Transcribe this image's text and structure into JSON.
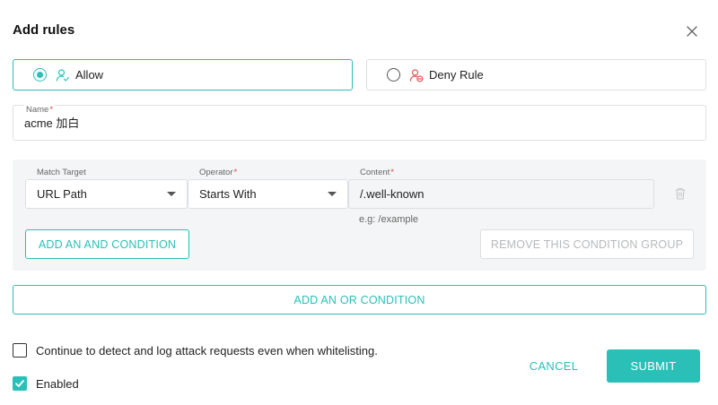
{
  "dialog": {
    "title": "Add rules"
  },
  "rule_types": {
    "allow": {
      "label": "Allow",
      "selected": true,
      "icon": "user-check-icon"
    },
    "deny": {
      "label": "Deny Rule",
      "selected": false,
      "icon": "user-block-icon"
    }
  },
  "name_field": {
    "label": "Name",
    "required_mark": "*",
    "value": "acme 加白"
  },
  "condition": {
    "match_target": {
      "label": "Match Target",
      "value": "URL Path"
    },
    "operator": {
      "label": "Operator",
      "required_mark": "*",
      "value": "Starts With"
    },
    "content": {
      "label": "Content",
      "required_mark": "*",
      "value": "/.well-known",
      "hint": "e.g: /example"
    },
    "add_and_label": "ADD AN AND CONDITION",
    "remove_group_label": "REMOVE THIS CONDITION GROUP"
  },
  "add_or_label": "ADD AN OR CONDITION",
  "options": {
    "continue_detect": {
      "label": "Continue to detect and log attack requests even when whitelisting.",
      "checked": false
    },
    "enabled": {
      "label": "Enabled",
      "checked": true
    }
  },
  "actions": {
    "cancel_label": "CANCEL",
    "submit_label": "SUBMIT"
  },
  "colors": {
    "accent": "#2ac0b8",
    "required": "#e54545",
    "deny_icon": "#e05555"
  }
}
